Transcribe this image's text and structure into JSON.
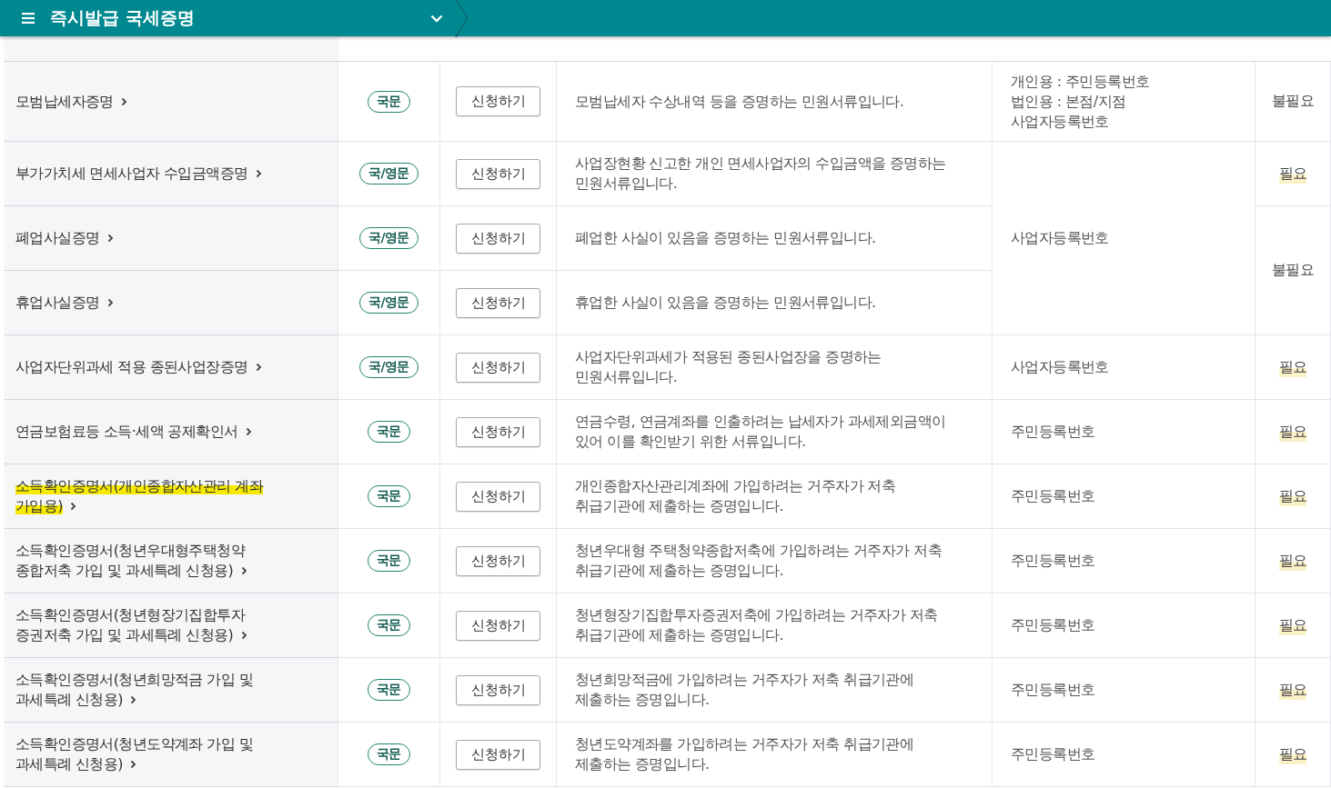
{
  "header": {
    "title": "즉시발급 국세증명"
  },
  "rows": [
    {
      "name": "모범납세자증명",
      "highlighted": false,
      "language": "국문",
      "button": "신청하기",
      "description": "모범납세자 수상내역 등을 증명하는 민원서류입니다.",
      "id_required": "개인용 : 주민등록번호\n법인용 : 본점/지점\n사업자등록번호",
      "seal_required": "불필요",
      "seal_marked": false
    },
    {
      "name": "부가가치세 면세사업자 수입금액증명",
      "highlighted": false,
      "language": "국/영문",
      "button": "신청하기",
      "description": "사업장현황 신고한 개인 면세사업자의 수입금액을 증명하는\n민원서류입니다.",
      "id_required": "사업자등록번호",
      "seal_required": "필요",
      "seal_marked": true
    },
    {
      "name": "폐업사실증명",
      "highlighted": false,
      "language": "국/영문",
      "button": "신청하기",
      "description": "폐업한 사실이 있음을 증명하는 민원서류입니다.",
      "seal_required": "불필요",
      "seal_marked": false
    },
    {
      "name": "휴업사실증명",
      "highlighted": false,
      "language": "국/영문",
      "button": "신청하기",
      "description": "휴업한 사실이 있음을 증명하는 민원서류입니다."
    },
    {
      "name": "사업자단위과세 적용 종된사업장증명",
      "highlighted": false,
      "language": "국/영문",
      "button": "신청하기",
      "description": "사업자단위과세가 적용된 종된사업장을 증명하는\n민원서류입니다.",
      "id_required": "사업자등록번호",
      "seal_required": "필요",
      "seal_marked": true
    },
    {
      "name": "연금보험료등 소득·세액 공제확인서",
      "highlighted": false,
      "language": "국문",
      "button": "신청하기",
      "description": "연금수령, 연금계좌를 인출하려는 납세자가 과세제외금액이\n있어 이를 확인받기 위한 서류입니다.",
      "id_required": "주민등록번호",
      "seal_required": "필요",
      "seal_marked": true
    },
    {
      "name": "소득확인증명서(개인종합자산관리 계좌\n가입용)",
      "highlighted": true,
      "language": "국문",
      "button": "신청하기",
      "description": "개인종합자산관리계좌에 가입하려는 거주자가 저축\n취급기관에 제출하는 증명입니다.",
      "id_required": "주민등록번호",
      "seal_required": "필요",
      "seal_marked": true
    },
    {
      "name": "소득확인증명서(청년우대형주택청약\n종합저축 가입 및 과세특례 신청용)",
      "highlighted": false,
      "language": "국문",
      "button": "신청하기",
      "description": "청년우대형 주택청약종합저축에 가입하려는 거주자가 저축\n취급기관에 제출하는 증명입니다.",
      "id_required": "주민등록번호",
      "seal_required": "필요",
      "seal_marked": true
    },
    {
      "name": "소득확인증명서(청년형장기집합투자\n증권저축 가입 및 과세특례 신청용)",
      "highlighted": false,
      "language": "국문",
      "button": "신청하기",
      "description": "청년형장기집합투자증권저축에 가입하려는 거주자가 저축\n취급기관에 제출하는 증명입니다.",
      "id_required": "주민등록번호",
      "seal_required": "필요",
      "seal_marked": true
    },
    {
      "name": "소득확인증명서(청년희망적금 가입 및\n과세특례 신청용)",
      "highlighted": false,
      "language": "국문",
      "button": "신청하기",
      "description": "청년희망적금에 가입하려는 거주자가 저축 취급기관에\n제출하는 증명입니다.",
      "id_required": "주민등록번호",
      "seal_required": "필요",
      "seal_marked": true
    },
    {
      "name": "소득확인증명서(청년도약계좌 가입 및\n과세특례 신청용)",
      "highlighted": false,
      "language": "국문",
      "button": "신청하기",
      "description": "청년도약계좌를 가입하려는 거주자가 저축 취급기관에\n제출하는 증명입니다.",
      "id_required": "주민등록번호",
      "seal_required": "필요",
      "seal_marked": true
    }
  ]
}
